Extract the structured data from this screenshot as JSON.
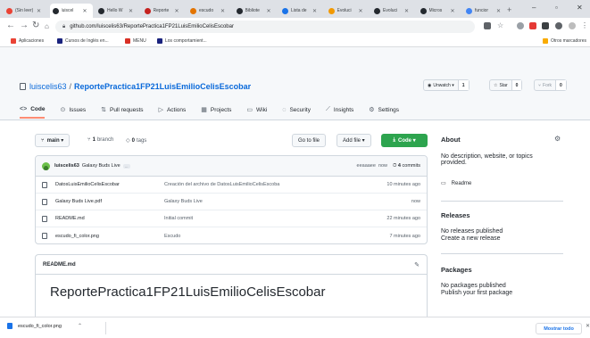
{
  "browser": {
    "tabs": [
      {
        "label": "(Sin leer)",
        "color": "#ea4335"
      },
      {
        "label": "luiscel",
        "color": "#24292f"
      },
      {
        "label": "Hello W",
        "color": "#24292f"
      },
      {
        "label": "Reporte",
        "color": "#c5221f"
      },
      {
        "label": "escudo",
        "color": "#e37400"
      },
      {
        "label": "Bibliote",
        "color": "#24292f"
      },
      {
        "label": "Lista de",
        "color": "#1a73e8"
      },
      {
        "label": "Evoluci",
        "color": "#f29900"
      },
      {
        "label": "Evoluci",
        "color": "#24292f"
      },
      {
        "label": "Micros",
        "color": "#24292f"
      },
      {
        "label": "funcior",
        "color": "#4285f4"
      }
    ],
    "url": "github.com/luiscelis63/ReportePractica1FP21LuisEmilioCelisEscobar",
    "bookmarks": [
      {
        "label": "Aplicaciones",
        "color": "#ea4335"
      },
      {
        "label": "Cursos de Inglés en...",
        "color": "#1a237e"
      },
      {
        "label": "MENU",
        "color": "#d93025"
      },
      {
        "label": "Los comportamient...",
        "color": "#1a237e"
      }
    ],
    "other_bookmarks": "Otros marcadores"
  },
  "repo": {
    "owner": "luiscelis63",
    "name": "ReportePractica1FP21LuisEmilioCelisEscobar",
    "unwatch_label": "Unwatch",
    "unwatch_count": "1",
    "star_label": "Star",
    "star_count": "0",
    "fork_label": "Fork",
    "fork_count": "0",
    "nav": [
      {
        "label": "Code",
        "icon": "<>"
      },
      {
        "label": "Issues",
        "icon": "⊙"
      },
      {
        "label": "Pull requests",
        "icon": "⇅"
      },
      {
        "label": "Actions",
        "icon": "▷"
      },
      {
        "label": "Projects",
        "icon": "▦"
      },
      {
        "label": "Wiki",
        "icon": "▭"
      },
      {
        "label": "Security",
        "icon": "◌"
      },
      {
        "label": "Insights",
        "icon": "⟋"
      },
      {
        "label": "Settings",
        "icon": "⚙"
      }
    ]
  },
  "filebar": {
    "branch": "main",
    "branches_count": "1",
    "branches_label": "branch",
    "tags_count": "0",
    "tags_label": "tags",
    "go_to_file": "Go to file",
    "add_file": "Add file",
    "code": "Code"
  },
  "commit": {
    "author": "luiscelis63",
    "message": "Galaxy Buds Live",
    "hash": "eeaaaee",
    "time": "now",
    "commits_count": "4",
    "commits_label": "commits"
  },
  "files": [
    {
      "name": "DatosLuisEmilioCelisEscobar",
      "message": "Creación del archivo de DatosLuisEmilioCelisEscoba",
      "time": "10 minutes ago"
    },
    {
      "name": "Galaxy Buds Live.pdf",
      "message": "Galaxy Buds Live",
      "time": "now"
    },
    {
      "name": "README.md",
      "message": "Initial commit",
      "time": "22 minutes ago"
    },
    {
      "name": "escudo_fi_color.png",
      "message": "Escudo",
      "time": "7 minutes ago"
    }
  ],
  "readme": {
    "filename": "README.md",
    "heading": "ReportePractica1FP21LuisEmilioCelisEscobar"
  },
  "sidebar": {
    "about_title": "About",
    "about_text": "No description, website, or topics provided.",
    "readme_link": "Readme",
    "releases_title": "Releases",
    "releases_text": "No releases published",
    "releases_link": "Create a new release",
    "packages_title": "Packages",
    "packages_text": "No packages published",
    "packages_link": "Publish your first package"
  },
  "downloads": {
    "file": "escudo_fi_color.png",
    "show_all": "Mostrar todo"
  }
}
